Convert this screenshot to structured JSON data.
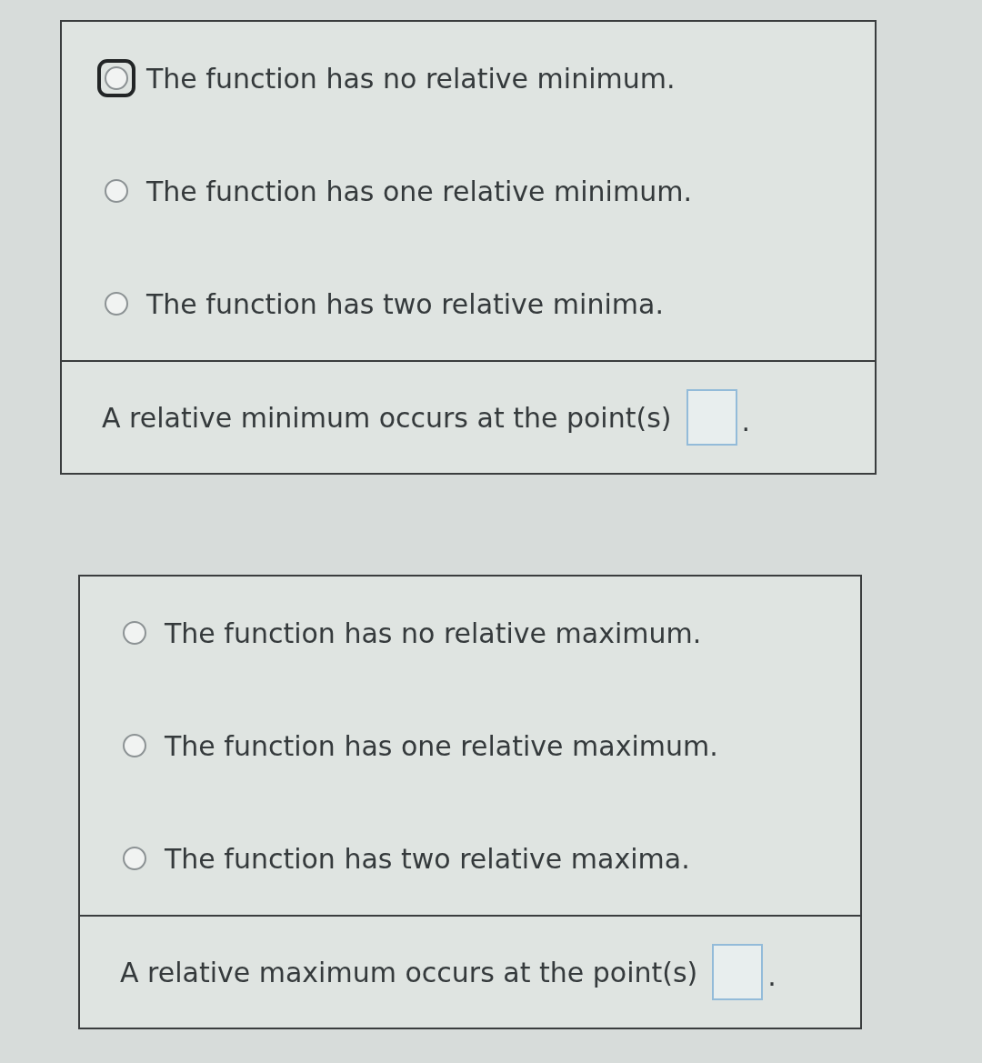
{
  "panels": [
    {
      "options": [
        {
          "label": "The function has no relative minimum.",
          "selected": false,
          "focused": true
        },
        {
          "label": "The function has one relative minimum.",
          "selected": false,
          "focused": false
        },
        {
          "label": "The function has two relative minima.",
          "selected": false,
          "focused": false
        }
      ],
      "answer": {
        "text": "A relative minimum occurs at the point(s)",
        "suffix": "."
      }
    },
    {
      "options": [
        {
          "label": "The function has no relative maximum.",
          "selected": false,
          "focused": false
        },
        {
          "label": "The function has one relative maximum.",
          "selected": false,
          "focused": false
        },
        {
          "label": "The function has two relative maxima.",
          "selected": false,
          "focused": false
        }
      ],
      "answer": {
        "text": "A relative maximum occurs at the point(s)",
        "suffix": "."
      }
    }
  ]
}
